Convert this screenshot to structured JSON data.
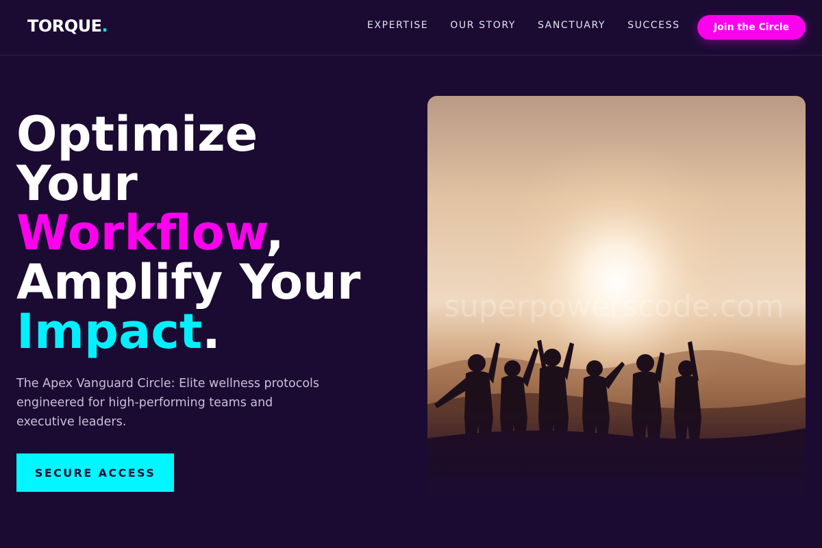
{
  "brand": {
    "name": "TORQUE",
    "dot": "."
  },
  "nav": {
    "links": [
      "EXPERTISE",
      "OUR STORY",
      "SANCTUARY",
      "SUCCESS"
    ],
    "cta_label": "Join the Circle"
  },
  "hero": {
    "title_line1": "Optimize",
    "title_line2": "Your",
    "title_line3_highlight": "Workflow",
    "title_line3_suffix": ",",
    "title_line4": "Amplify Your",
    "title_line5_highlight": "Impact",
    "title_line5_suffix": ".",
    "subtitle": "The Apex Vanguard Circle: Elite wellness protocols engineered for high-performing teams and executive leaders.",
    "cta_label": "SECURE ACCESS",
    "image_watermark": "superpowerscode.com"
  },
  "colors": {
    "background": "#1b0b33",
    "accent_magenta": "#ff00ee",
    "accent_cyan": "#00f0ff"
  }
}
